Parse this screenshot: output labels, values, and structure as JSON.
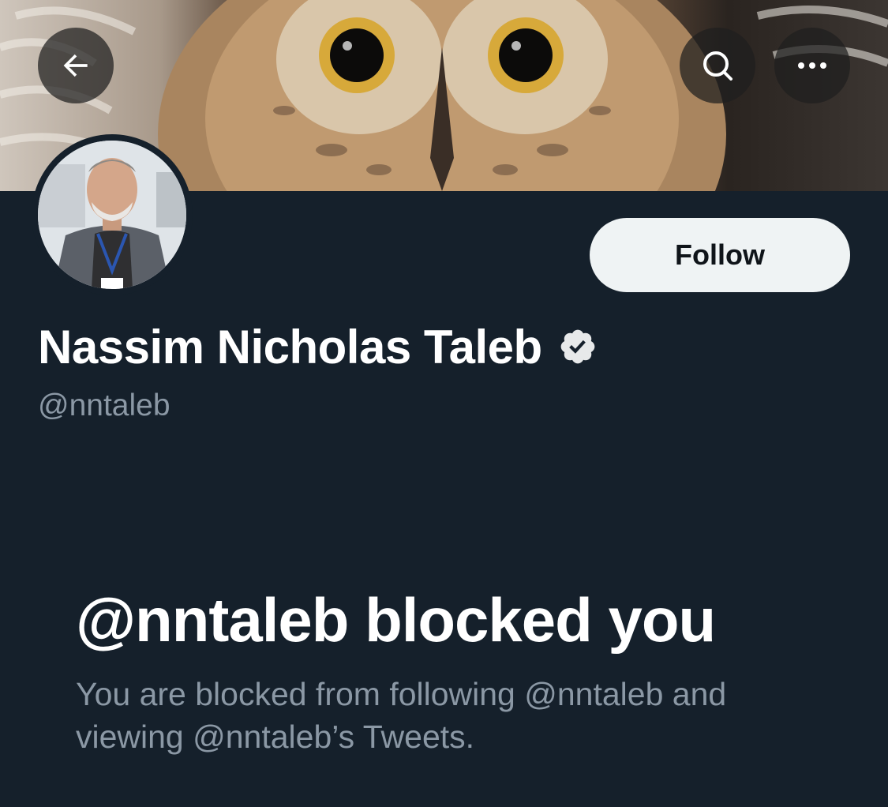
{
  "profile": {
    "display_name": "Nassim Nicholas Taleb",
    "handle": "@nntaleb",
    "verified": true
  },
  "header": {
    "back_icon": "arrow-left-icon",
    "search_icon": "search-icon",
    "more_icon": "more-horizontal-icon"
  },
  "actions": {
    "follow_label": "Follow"
  },
  "blocked": {
    "title": "@nntaleb blocked you",
    "description": "You are blocked from following @nntaleb and viewing @nntaleb’s Tweets."
  },
  "colors": {
    "background": "#15202b",
    "text_primary": "#ffffff",
    "text_secondary": "#8b98a5",
    "follow_bg": "#eff3f4",
    "follow_text": "#0f1419"
  }
}
